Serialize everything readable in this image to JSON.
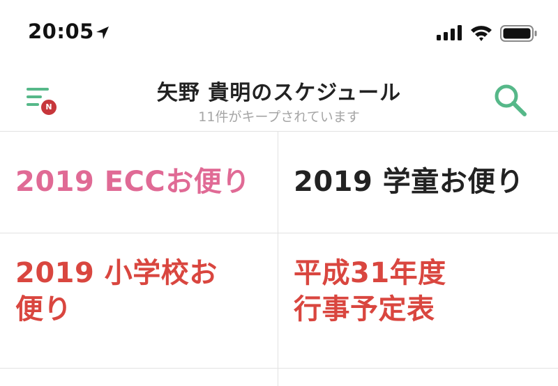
{
  "status_bar": {
    "time": "20:05"
  },
  "header": {
    "title": "矢野 貴明のスケジュール",
    "subtitle": "11件がキープされています",
    "menu_badge": "N",
    "accent_color": "#56b889",
    "badge_color": "#c7363b"
  },
  "icons": {
    "location": "location-arrow-icon",
    "signal": "cellular-signal-icon",
    "wifi": "wifi-icon",
    "battery": "battery-icon",
    "menu": "hamburger-menu-icon",
    "search": "search-icon"
  },
  "notes": [
    {
      "title_lines": [
        "2019 ECCお便り"
      ],
      "color": "#e06a95"
    },
    {
      "title_lines": [
        "2019 学童お便り"
      ],
      "color": "#222222"
    },
    {
      "title_lines": [
        "2019 小学校お",
        "便り"
      ],
      "color": "#d9463f"
    },
    {
      "title_lines": [
        "平成31年度",
        "行事予定表"
      ],
      "color": "#d9463f"
    }
  ]
}
